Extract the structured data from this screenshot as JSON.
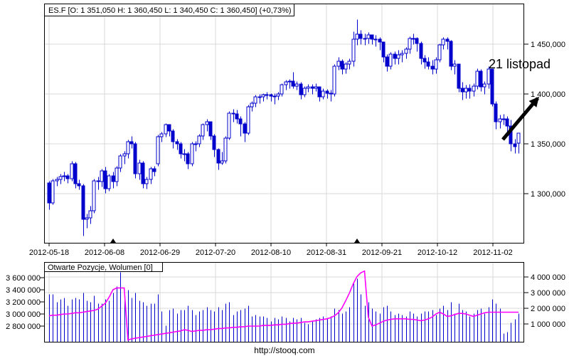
{
  "footer": {
    "url": "http://stooq.com"
  },
  "colors": {
    "candle": "#0000cc",
    "volume_bar": "#0000cc",
    "open_interest_line": "#ff00ff",
    "grid": "#d9d9d9",
    "axis": "#000000",
    "annotation": "#000000",
    "background": "#ffffff"
  },
  "chart_data": [
    {
      "type": "candlestick",
      "title": "ES.F [O: 1 351,050  H: 1 360,450  L: 1 340,450  C: 1 360,450] (+0,73%)",
      "symbol": "ES.F",
      "last_quote": {
        "open": 1351.05,
        "high": 1360.45,
        "low": 1340.45,
        "close": 1360.45,
        "change_pct": "+0,73%"
      },
      "annotation": {
        "text": "21 listopad"
      },
      "y_tick_labels": [
        "1 450,000",
        "1 400,000",
        "1 350,000",
        "1 300,000"
      ],
      "y_tick_values": [
        1450,
        1400,
        1350,
        1300
      ],
      "ylim": [
        1250,
        1490
      ],
      "x_tick_labels": [
        "2012-05-18",
        "2012-06-08",
        "2012-06-29",
        "2012-07-20",
        "2012-08-10",
        "2012-08-31",
        "2012-09-21",
        "2012-10-12",
        "2012-11-02"
      ],
      "x_tick_indices": [
        0,
        14,
        29,
        43,
        58,
        73,
        87,
        102,
        115
      ],
      "rollover_marker_dates": [
        "2012-06-13",
        "2012-09-14"
      ],
      "rollover_marker_indices": [
        17,
        82
      ],
      "grid": true,
      "dates": [
        "2012-05-18",
        "2012-05-21",
        "2012-05-22",
        "2012-05-23",
        "2012-05-24",
        "2012-05-25",
        "2012-05-29",
        "2012-05-30",
        "2012-05-31",
        "2012-06-01",
        "2012-06-04",
        "2012-06-05",
        "2012-06-06",
        "2012-06-07",
        "2012-06-08",
        "2012-06-11",
        "2012-06-12",
        "2012-06-13",
        "2012-06-14",
        "2012-06-15",
        "2012-06-18",
        "2012-06-19",
        "2012-06-20",
        "2012-06-21",
        "2012-06-22",
        "2012-06-25",
        "2012-06-26",
        "2012-06-27",
        "2012-06-28",
        "2012-06-29",
        "2012-07-02",
        "2012-07-03",
        "2012-07-05",
        "2012-07-06",
        "2012-07-09",
        "2012-07-10",
        "2012-07-11",
        "2012-07-12",
        "2012-07-13",
        "2012-07-16",
        "2012-07-17",
        "2012-07-18",
        "2012-07-19",
        "2012-07-20",
        "2012-07-23",
        "2012-07-24",
        "2012-07-25",
        "2012-07-26",
        "2012-07-27",
        "2012-07-30",
        "2012-07-31",
        "2012-08-01",
        "2012-08-02",
        "2012-08-03",
        "2012-08-06",
        "2012-08-07",
        "2012-08-08",
        "2012-08-09",
        "2012-08-10",
        "2012-08-13",
        "2012-08-14",
        "2012-08-15",
        "2012-08-16",
        "2012-08-17",
        "2012-08-20",
        "2012-08-21",
        "2012-08-22",
        "2012-08-23",
        "2012-08-24",
        "2012-08-27",
        "2012-08-28",
        "2012-08-29",
        "2012-08-30",
        "2012-08-31",
        "2012-09-04",
        "2012-09-05",
        "2012-09-06",
        "2012-09-07",
        "2012-09-10",
        "2012-09-11",
        "2012-09-12",
        "2012-09-13",
        "2012-09-14",
        "2012-09-17",
        "2012-09-18",
        "2012-09-19",
        "2012-09-20",
        "2012-09-21",
        "2012-09-24",
        "2012-09-25",
        "2012-09-26",
        "2012-09-27",
        "2012-09-28",
        "2012-10-01",
        "2012-10-02",
        "2012-10-03",
        "2012-10-04",
        "2012-10-05",
        "2012-10-08",
        "2012-10-09",
        "2012-10-10",
        "2012-10-11",
        "2012-10-12",
        "2012-10-15",
        "2012-10-16",
        "2012-10-17",
        "2012-10-18",
        "2012-10-19",
        "2012-10-22",
        "2012-10-23",
        "2012-10-24",
        "2012-10-25",
        "2012-10-26",
        "2012-10-31",
        "2012-11-01",
        "2012-11-02",
        "2012-11-05",
        "2012-11-06",
        "2012-11-07",
        "2012-11-08",
        "2012-11-09",
        "2012-11-12",
        "2012-11-13",
        "2012-11-14",
        "2012-11-15",
        "2012-11-16"
      ],
      "ohlc": [
        [
          1311,
          1313,
          1284,
          1291
        ],
        [
          1291,
          1315,
          1289,
          1313
        ],
        [
          1313,
          1317,
          1308,
          1314
        ],
        [
          1314,
          1320,
          1310,
          1317
        ],
        [
          1317,
          1322,
          1313,
          1318
        ],
        [
          1318,
          1320,
          1311,
          1315
        ],
        [
          1315,
          1333,
          1313,
          1330
        ],
        [
          1330,
          1332,
          1306,
          1310
        ],
        [
          1310,
          1314,
          1304,
          1308
        ],
        [
          1308,
          1310,
          1258,
          1274
        ],
        [
          1274,
          1280,
          1266,
          1276
        ],
        [
          1276,
          1288,
          1270,
          1283
        ],
        [
          1283,
          1315,
          1281,
          1313
        ],
        [
          1313,
          1317,
          1304,
          1312
        ],
        [
          1312,
          1325,
          1307,
          1323
        ],
        [
          1323,
          1327,
          1301,
          1305
        ],
        [
          1305,
          1320,
          1303,
          1318
        ],
        [
          1318,
          1322,
          1306,
          1312
        ],
        [
          1312,
          1328,
          1308,
          1326
        ],
        [
          1326,
          1340,
          1322,
          1338
        ],
        [
          1338,
          1343,
          1330,
          1340
        ],
        [
          1340,
          1354,
          1336,
          1352
        ],
        [
          1352,
          1358,
          1346,
          1350
        ],
        [
          1350,
          1352,
          1316,
          1320
        ],
        [
          1320,
          1334,
          1314,
          1331
        ],
        [
          1331,
          1333,
          1306,
          1310
        ],
        [
          1310,
          1317,
          1305,
          1314
        ],
        [
          1314,
          1327,
          1310,
          1325
        ],
        [
          1325,
          1328,
          1318,
          1322
        ],
        [
          1330,
          1359,
          1328,
          1357
        ],
        [
          1357,
          1362,
          1352,
          1360
        ],
        [
          1360,
          1371,
          1357,
          1369
        ],
        [
          1369,
          1370,
          1358,
          1363
        ],
        [
          1363,
          1365,
          1346,
          1352
        ],
        [
          1352,
          1355,
          1344,
          1350
        ],
        [
          1350,
          1352,
          1336,
          1340
        ],
        [
          1340,
          1345,
          1333,
          1340
        ],
        [
          1340,
          1342,
          1325,
          1330
        ],
        [
          1330,
          1352,
          1328,
          1350
        ],
        [
          1350,
          1353,
          1343,
          1350
        ],
        [
          1350,
          1360,
          1347,
          1358
        ],
        [
          1358,
          1371,
          1354,
          1369
        ],
        [
          1369,
          1375,
          1363,
          1372
        ],
        [
          1372,
          1373,
          1354,
          1358
        ],
        [
          1358,
          1360,
          1337,
          1344
        ],
        [
          1344,
          1346,
          1324,
          1331
        ],
        [
          1331,
          1342,
          1329,
          1333
        ],
        [
          1333,
          1358,
          1331,
          1356
        ],
        [
          1356,
          1383,
          1354,
          1381
        ],
        [
          1381,
          1385,
          1372,
          1380
        ],
        [
          1380,
          1384,
          1371,
          1375
        ],
        [
          1375,
          1378,
          1358,
          1370
        ],
        [
          1370,
          1372,
          1352,
          1361
        ],
        [
          1361,
          1389,
          1359,
          1387
        ],
        [
          1387,
          1393,
          1383,
          1391
        ],
        [
          1391,
          1399,
          1387,
          1397
        ],
        [
          1397,
          1400,
          1391,
          1397
        ],
        [
          1397,
          1401,
          1393,
          1399
        ],
        [
          1399,
          1402,
          1395,
          1399
        ],
        [
          1399,
          1401,
          1393,
          1398
        ],
        [
          1398,
          1401,
          1390,
          1398
        ],
        [
          1398,
          1402,
          1394,
          1400
        ],
        [
          1400,
          1411,
          1398,
          1409
        ],
        [
          1409,
          1414,
          1404,
          1412
        ],
        [
          1412,
          1415,
          1406,
          1413
        ],
        [
          1413,
          1422,
          1406,
          1408
        ],
        [
          1408,
          1413,
          1404,
          1410
        ],
        [
          1410,
          1412,
          1395,
          1399
        ],
        [
          1399,
          1408,
          1397,
          1406
        ],
        [
          1406,
          1410,
          1402,
          1407
        ],
        [
          1407,
          1410,
          1400,
          1406
        ],
        [
          1406,
          1411,
          1403,
          1407
        ],
        [
          1407,
          1408,
          1393,
          1397
        ],
        [
          1397,
          1406,
          1395,
          1403
        ],
        [
          1403,
          1405,
          1396,
          1401
        ],
        [
          1401,
          1404,
          1393,
          1400
        ],
        [
          1400,
          1430,
          1398,
          1428
        ],
        [
          1428,
          1437,
          1424,
          1433
        ],
        [
          1433,
          1435,
          1420,
          1425
        ],
        [
          1425,
          1432,
          1421,
          1430
        ],
        [
          1430,
          1436,
          1425,
          1433
        ],
        [
          1433,
          1463,
          1428,
          1455
        ],
        [
          1455,
          1474.75,
          1449,
          1460
        ],
        [
          1460,
          1464,
          1450,
          1456
        ],
        [
          1456,
          1461,
          1449,
          1456
        ],
        [
          1456,
          1462,
          1451,
          1459
        ],
        [
          1459,
          1460,
          1450,
          1455
        ],
        [
          1455,
          1459,
          1448,
          1455
        ],
        [
          1455,
          1457,
          1444,
          1452
        ],
        [
          1452,
          1453,
          1432,
          1437
        ],
        [
          1437,
          1440,
          1423,
          1428
        ],
        [
          1428,
          1442,
          1425,
          1440
        ],
        [
          1440,
          1443,
          1430,
          1436
        ],
        [
          1436,
          1444,
          1430,
          1439
        ],
        [
          1439,
          1444,
          1432,
          1441
        ],
        [
          1441,
          1447,
          1436,
          1445
        ],
        [
          1445,
          1458,
          1441,
          1456
        ],
        [
          1456,
          1461,
          1450,
          1456
        ],
        [
          1456,
          1457,
          1443,
          1451
        ],
        [
          1451,
          1453,
          1430,
          1436
        ],
        [
          1436,
          1439,
          1426,
          1432
        ],
        [
          1432,
          1437,
          1425,
          1428
        ],
        [
          1428,
          1434,
          1420,
          1425
        ],
        [
          1425,
          1437,
          1421,
          1434
        ],
        [
          1434,
          1451,
          1432,
          1449
        ],
        [
          1449,
          1457,
          1445,
          1455
        ],
        [
          1455,
          1457,
          1445,
          1453
        ],
        [
          1453,
          1454,
          1424,
          1428
        ],
        [
          1428,
          1434,
          1420,
          1430
        ],
        [
          1430,
          1431,
          1402,
          1406
        ],
        [
          1406,
          1412,
          1394,
          1402
        ],
        [
          1402,
          1409,
          1396,
          1406
        ],
        [
          1406,
          1410,
          1396,
          1403
        ],
        [
          1403,
          1411,
          1398,
          1408
        ],
        [
          1408,
          1426,
          1405,
          1423
        ],
        [
          1423,
          1425,
          1403,
          1407
        ],
        [
          1407,
          1413,
          1400,
          1410
        ],
        [
          1410,
          1428,
          1406,
          1425
        ],
        [
          1425,
          1426,
          1388,
          1390
        ],
        [
          1390,
          1393,
          1365,
          1372
        ],
        [
          1372,
          1379,
          1366,
          1375
        ],
        [
          1375,
          1380,
          1369,
          1375
        ],
        [
          1375,
          1378,
          1360,
          1368
        ],
        [
          1368,
          1374,
          1343,
          1350
        ],
        [
          1350,
          1355,
          1341,
          1347
        ],
        [
          1351.05,
          1360.45,
          1340.45,
          1360.45
        ]
      ]
    },
    {
      "type": "bar+line",
      "title": "Otwarte Pozycje, Wolumen [0]",
      "series_names": {
        "line": "Otwarte Pozycje",
        "bars": "Wolumen"
      },
      "left_tick_labels": [
        "3 600 000",
        "3 400 000",
        "3 200 000",
        "3 000 000",
        "2 800 000"
      ],
      "left_tick_values": [
        3600000,
        3400000,
        3200000,
        3000000,
        2800000
      ],
      "right_tick_labels": [
        "4 000 000",
        "3 000 000",
        "2 000 000",
        "1 000 000"
      ],
      "right_tick_values": [
        4000000,
        3000000,
        2000000,
        1000000
      ],
      "grid": true,
      "volume_millions": [
        2.9,
        2.9,
        2.4,
        2.6,
        2.7,
        2.2,
        2.6,
        2.7,
        2.6,
        3.0,
        2.5,
        2.4,
        2.8,
        2.3,
        2.3,
        2.6,
        2.5,
        3.0,
        3.4,
        4.3,
        2.6,
        3.2,
        2.7,
        3.0,
        2.5,
        2.4,
        2.2,
        2.3,
        2.3,
        2.9,
        1.8,
        0.9,
        1.9,
        2.0,
        1.7,
        1.9,
        1.9,
        2.2,
        1.9,
        1.6,
        1.8,
        1.9,
        2.1,
        1.9,
        1.8,
        2.1,
        1.9,
        2.3,
        2.4,
        1.6,
        1.8,
        1.9,
        2.0,
        2.2,
        1.5,
        1.6,
        1.5,
        1.5,
        1.4,
        1.2,
        1.4,
        1.3,
        1.5,
        1.4,
        1.2,
        1.4,
        1.3,
        1.4,
        1.1,
        1.0,
        1.2,
        1.3,
        1.4,
        1.5,
        1.4,
        1.5,
        2.0,
        1.9,
        1.7,
        1.8,
        2.1,
        3.6,
        3.9,
        2.9,
        2.2,
        2.4,
        2.0,
        1.8,
        1.7,
        2.1,
        2.2,
        1.8,
        1.6,
        1.7,
        1.6,
        1.5,
        1.8,
        1.7,
        1.5,
        1.7,
        1.8,
        1.8,
        1.9,
        1.6,
        2.0,
        2.2,
        1.9,
        2.4,
        1.7,
        2.3,
        1.9,
        1.8,
        1.5,
        1.7,
        1.9,
        2.0,
        1.7,
        2.1,
        2.6,
        2.3,
        2.0,
        0.4,
        0.5,
        1.1,
        1.3,
        1.7
      ],
      "open_interest_millions": [
        2.97,
        2.98,
        2.98,
        2.99,
        3.0,
        3.0,
        3.01,
        3.02,
        3.02,
        3.03,
        3.04,
        3.05,
        3.06,
        3.08,
        3.13,
        3.18,
        3.28,
        3.4,
        3.43,
        3.43,
        3.43,
        2.57,
        2.59,
        2.6,
        2.61,
        2.62,
        2.63,
        2.64,
        2.65,
        2.66,
        2.67,
        2.68,
        2.69,
        2.7,
        2.71,
        2.72,
        2.74,
        2.73,
        2.71,
        2.72,
        2.73,
        2.73,
        2.74,
        2.74,
        2.75,
        2.76,
        2.76,
        2.77,
        2.77,
        2.78,
        2.78,
        2.79,
        2.79,
        2.8,
        2.8,
        2.8,
        2.8,
        2.81,
        2.81,
        2.81,
        2.82,
        2.82,
        2.83,
        2.83,
        2.84,
        2.85,
        2.85,
        2.86,
        2.87,
        2.87,
        2.88,
        2.89,
        2.9,
        2.91,
        2.92,
        2.94,
        2.97,
        3.02,
        3.1,
        3.22,
        3.35,
        3.5,
        3.62,
        3.68,
        3.71,
        2.95,
        2.8,
        2.82,
        2.85,
        2.88,
        2.9,
        2.91,
        2.92,
        2.92,
        2.92,
        2.92,
        2.91,
        2.91,
        2.9,
        2.89,
        2.9,
        2.92,
        2.95,
        3.0,
        3.03,
        3.0,
        2.96,
        2.97,
        2.99,
        3.01,
        3.01,
        3.0,
        2.98,
        2.96,
        2.98,
        3.0,
        3.02,
        3.03,
        3.03,
        3.03,
        3.03,
        3.03,
        3.03,
        3.03,
        3.03,
        3.03
      ]
    }
  ]
}
